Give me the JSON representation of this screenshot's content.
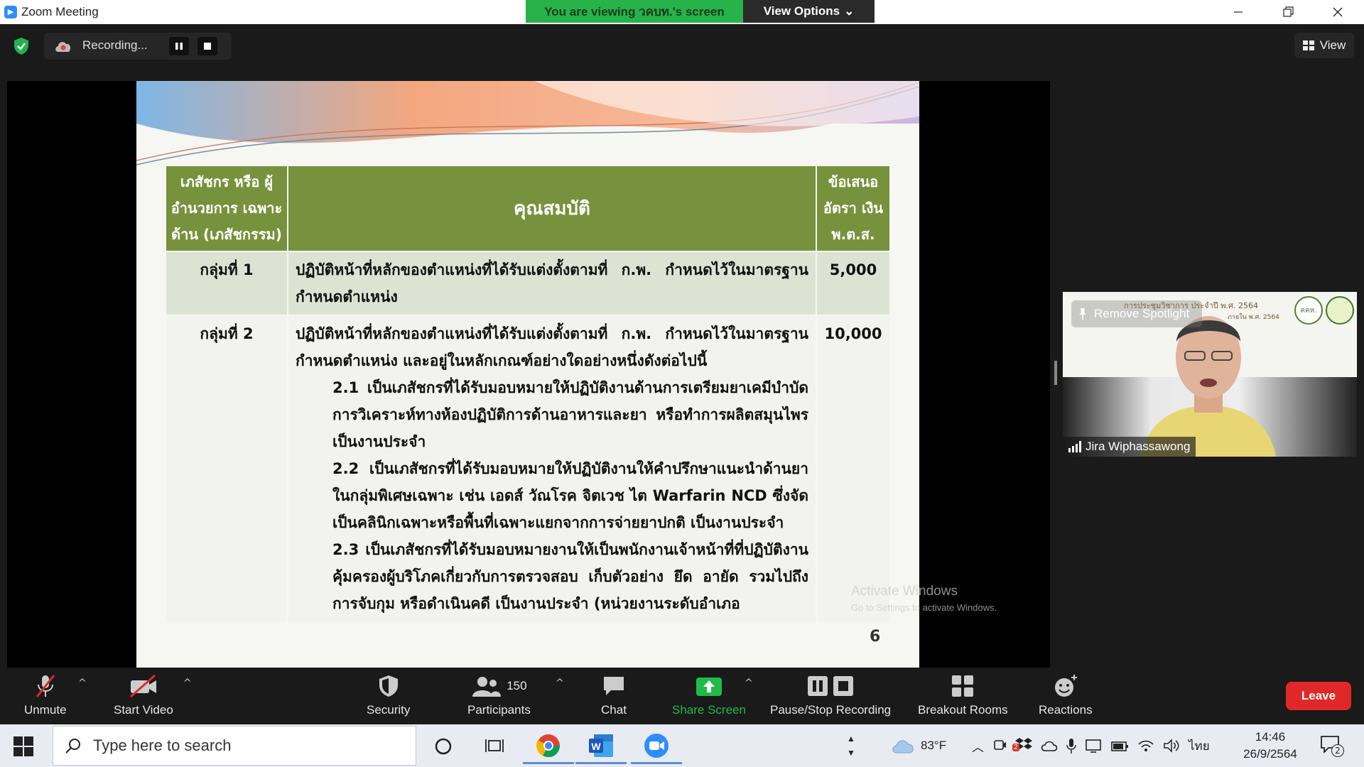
{
  "window": {
    "title": "Zoom Meeting",
    "viewing_banner": "You are viewing วคบท.'s screen",
    "view_options_label": "View Options",
    "view_options_caret": "⌄"
  },
  "meeting_top": {
    "recording_label": "Recording...",
    "view_label": "View"
  },
  "slide": {
    "table_headers": [
      "เภสัชกร หรือ ผู้อำนวยการ เฉพาะด้าน (เภสัชกรรม)",
      "คุณสมบัติ",
      "ข้อเสนอ อัตรา เงิน พ.ต.ส."
    ],
    "rows": [
      {
        "group": "กลุ่มที่ 1",
        "description": "ปฏิบัติหน้าที่หลักของตำแหน่งที่ได้รับแต่งตั้งตามที่ ก.พ. กำหนดไว้ในมาตรฐานกำหนดตำแหน่ง",
        "rate": "5,000"
      },
      {
        "group": "กลุ่มที่ 2",
        "description": "ปฏิบัติหน้าที่หลักของตำแหน่งที่ได้รับแต่งตั้งตามที่ ก.พ. กำหนดไว้ในมาตรฐานกำหนดตำแหน่ง และอยู่ในหลักเกณฑ์อย่างใดอย่างหนึ่งดังต่อไปนี้",
        "items": [
          "2.1 เป็นเภสัชกรที่ได้รับมอบหมายให้ปฏิบัติงานด้านการเตรียมยาเคมีบำบัด การวิเคราะห์ทางห้องปฏิบัติการด้านอาหารและยา หรือทำการผลิตสมุนไพร เป็นงานประจำ",
          "2.2 เป็นเภสัชกรที่ได้รับมอบหมายให้ปฏิบัติงานให้คำปรึกษาแนะนำด้านยาในกลุ่มพิเศษเฉพาะ เช่น เอดส์ วัณโรค จิตเวช ไต Warfarin NCD ซึ่งจัดเป็นคลินิกเฉพาะหรือพื้นที่เฉพาะแยกจากการจ่ายยาปกติ เป็นงานประจำ",
          "2.3 เป็นเภสัชกรที่ได้รับมอบหมายงานให้เป็นพนักงานเจ้าหน้าที่ที่ปฏิบัติงานคุ้มครองผู้บริโภคเกี่ยวกับการตรวจสอบ เก็บตัวอย่าง ยึด อายัด รวมไปถึงการจับกุม หรือดำเนินคดี เป็นงานประจำ (หน่วยงานระดับอำเภอ"
        ],
        "rate": "10,000"
      }
    ],
    "page_number": "6"
  },
  "watermark": {
    "line1": "Activate Windows",
    "line2": "Go to Settings to activate Windows."
  },
  "video_tile": {
    "spotlight_label": "Remove Spotlight",
    "participant_name": "Jira Wiphassawong",
    "caption_line1": "การประชุมวิชาการ ประจำปี พ.ศ. 2564",
    "caption_line2": "ภายใน พ.ศ. 2564",
    "logo_text": "คคห."
  },
  "toolbar": {
    "unmute": "Unmute",
    "start_video": "Start Video",
    "security": "Security",
    "participants": "Participants",
    "participant_count": "150",
    "chat": "Chat",
    "share_screen": "Share Screen",
    "pause_stop": "Pause/Stop Recording",
    "breakout": "Breakout Rooms",
    "reactions": "Reactions",
    "leave": "Leave",
    "caret": "^"
  },
  "taskbar": {
    "search_placeholder": "Type here to search",
    "temperature": "83°F",
    "language": "ไทย",
    "time": "14:46",
    "date": "26/9/2564",
    "notification_count": "2",
    "badge_count": "2"
  },
  "colors": {
    "zoom_blue": "#2d8cff",
    "banner_green": "#27b24a",
    "table_header_green": "#76923c",
    "leave_red": "#e02828",
    "share_green": "#1fbb4b"
  }
}
